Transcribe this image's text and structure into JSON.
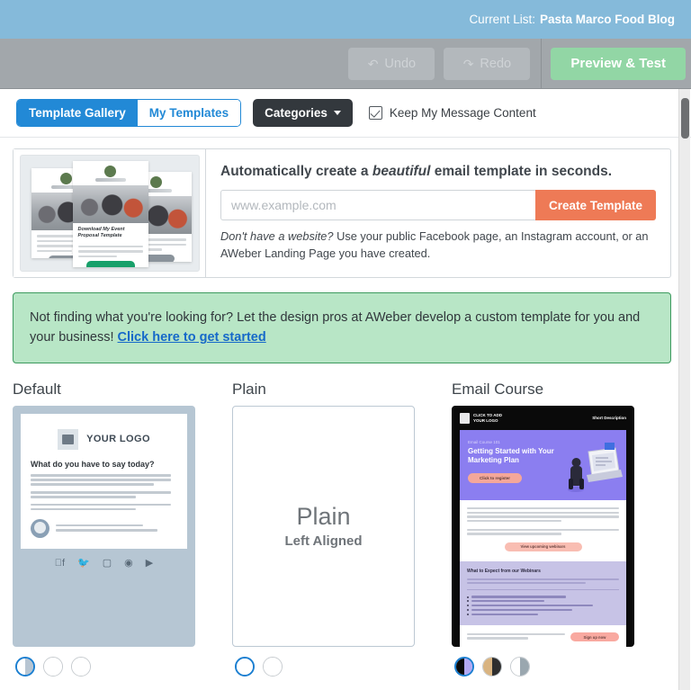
{
  "topbar": {
    "current_list_label": "Current List:",
    "current_list_value": "Pasta Marco Food Blog"
  },
  "toolbar": {
    "undo_label": "Undo",
    "undo_icon": "undo-arrow-icon",
    "redo_label": "Redo",
    "redo_icon": "redo-arrow-icon",
    "preview_label": "Preview & Test"
  },
  "tabs": {
    "template_gallery": "Template Gallery",
    "my_templates": "My Templates",
    "categories": "Categories",
    "keep_content": "Keep My Message Content"
  },
  "auto_panel": {
    "heading_before": "Automatically create a ",
    "heading_em": "beautiful",
    "heading_after": " email template in seconds.",
    "url_placeholder": "www.example.com",
    "url_value": "",
    "create_button": "Create Template",
    "note_em": "Don't have a website?",
    "note_rest": " Use your public Facebook page, an Instagram account, or an AWeber Landing Page you have created.",
    "thumb_title": "Download My Event Proposal Template"
  },
  "promo": {
    "text": "Not finding what you're looking for? Let the design pros at AWeber develop a custom template for you and your business!",
    "link": "Click here to get started"
  },
  "templates": [
    {
      "title": "Default",
      "logo_text": "YOUR LOGO",
      "heading": "What do you have to say today?",
      "social": [
        "f",
        "\u0001",
        "\u0001",
        "\u0001",
        "\u0001"
      ],
      "swatches": [
        {
          "left": "#ffffff",
          "right": "#b7c5d2",
          "selected": true
        },
        {
          "left": "#ffffff",
          "right": "#ffffff",
          "selected": false
        },
        {
          "left": "#ffffff",
          "right": "#ffffff",
          "selected": false
        }
      ]
    },
    {
      "title": "Plain",
      "big_text": "Plain",
      "small_text": "Left Aligned",
      "swatches": [
        {
          "left": "#ffffff",
          "right": "#ffffff",
          "selected": true
        },
        {
          "left": "#ffffff",
          "right": "#ffffff",
          "selected": false
        }
      ]
    },
    {
      "title": "Email Course",
      "logo_line1": "CLICK TO ADD",
      "logo_line2": "YOUR LOGO",
      "short_description": "Short Description",
      "eyebrow": "Email Course 101",
      "hero_title": "Getting Started with Your Marketing Plan",
      "hero_cta": "Click to register",
      "body_cta": "View upcoming webinars",
      "panel_heading": "What to Expect from our Webinars",
      "footer_cta": "Sign up now",
      "swatches": [
        {
          "left": "#0a0a0a",
          "right": "#b3a9f3",
          "selected": true
        },
        {
          "left": "#d9b481",
          "right": "#2e2e2e",
          "selected": false
        },
        {
          "left": "#ffffff",
          "right": "#9aa7af",
          "selected": false
        }
      ]
    }
  ],
  "colors": {
    "topbar_blue": "#85bada",
    "toolbar_gray": "#a2a7ab",
    "accent_blue": "#2289d6",
    "create_orange": "#ee7a56",
    "preview_green": "#92d6a5",
    "promo_green": "#b8e6c6"
  }
}
